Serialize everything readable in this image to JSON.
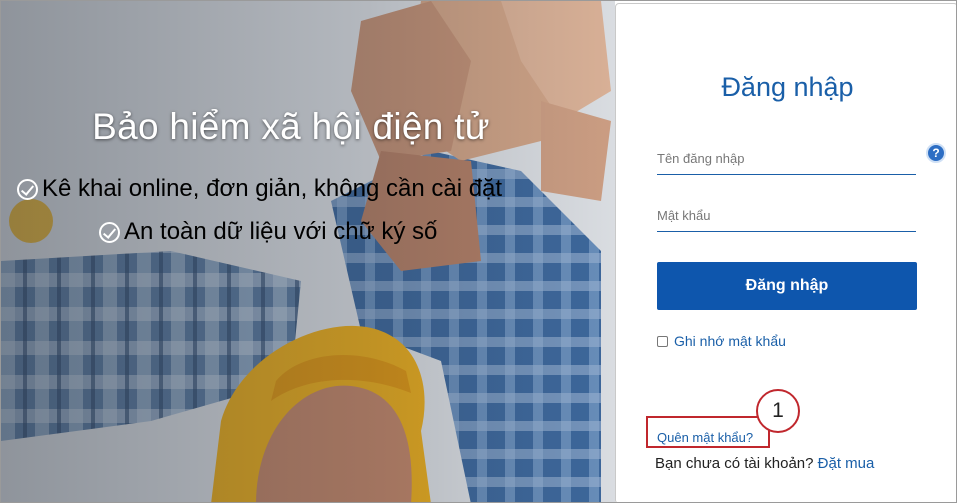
{
  "hero": {
    "title": "Bảo hiểm xã hội điện tử",
    "lines": [
      "Kê khai online, đơn giản, không cần cài đặt",
      "An toàn dữ liệu với chữ ký số"
    ]
  },
  "login": {
    "title": "Đăng nhập",
    "username_placeholder": "Tên đăng nhập",
    "password_placeholder": "Mật khẩu",
    "help_glyph": "?",
    "submit_label": "Đăng nhập",
    "remember_label": "Ghi nhớ mật khẩu",
    "remember_checked": false,
    "forgot_label": "Quên mật khẩu?",
    "signup_prompt": "Bạn chưa có tài khoản?",
    "signup_link": "Đặt mua"
  },
  "annotation": {
    "callout_number": "1",
    "highlight_color": "#c0272d"
  },
  "colors": {
    "brand_blue": "#1a5fa8",
    "button_blue": "#0e56ad"
  },
  "icons": {
    "hero_check": "check-circle-icon",
    "help": "question-circle-icon"
  }
}
